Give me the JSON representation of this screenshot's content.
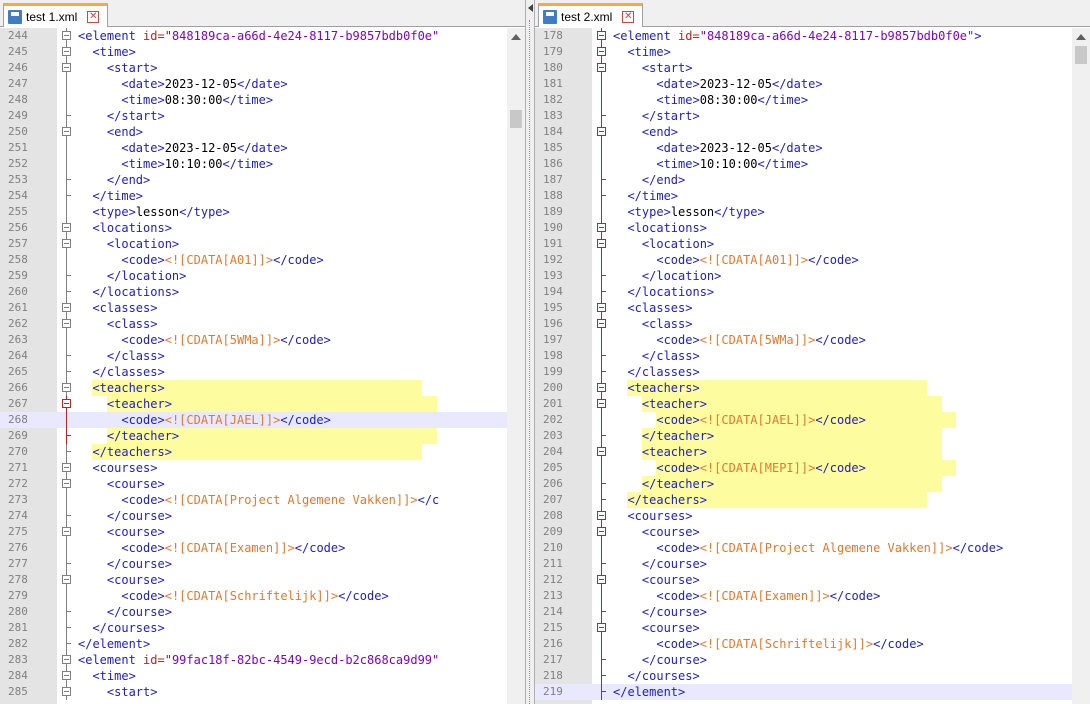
{
  "left": {
    "tab_title": "test 1.xml",
    "rows": [
      {
        "n": "244",
        "i": 3,
        "t": [
          [
            "tag",
            "<element "
          ],
          [
            "attr",
            "id="
          ],
          [
            "val",
            "\"848189ca-a66d-4e24-8117-b9857bdb0f0e\""
          ]
        ],
        "f": "box"
      },
      {
        "n": "245",
        "i": 4,
        "t": [
          [
            "tag",
            "<time>"
          ]
        ],
        "f": "box"
      },
      {
        "n": "246",
        "i": 5,
        "t": [
          [
            "tag",
            "<start>"
          ]
        ],
        "f": "box"
      },
      {
        "n": "247",
        "i": 6,
        "t": [
          [
            "tag",
            "<date>"
          ],
          [
            "txt",
            "2023-12-05"
          ],
          [
            "tag",
            "</date>"
          ]
        ],
        "f": "line"
      },
      {
        "n": "248",
        "i": 6,
        "t": [
          [
            "tag",
            "<time>"
          ],
          [
            "txt",
            "08:30:00"
          ],
          [
            "tag",
            "</time>"
          ]
        ],
        "f": "line"
      },
      {
        "n": "249",
        "i": 5,
        "t": [
          [
            "tag",
            "</start>"
          ]
        ],
        "f": "end"
      },
      {
        "n": "250",
        "i": 5,
        "t": [
          [
            "tag",
            "<end>"
          ]
        ],
        "f": "box"
      },
      {
        "n": "251",
        "i": 6,
        "t": [
          [
            "tag",
            "<date>"
          ],
          [
            "txt",
            "2023-12-05"
          ],
          [
            "tag",
            "</date>"
          ]
        ],
        "f": "line"
      },
      {
        "n": "252",
        "i": 6,
        "t": [
          [
            "tag",
            "<time>"
          ],
          [
            "txt",
            "10:10:00"
          ],
          [
            "tag",
            "</time>"
          ]
        ],
        "f": "line"
      },
      {
        "n": "253",
        "i": 5,
        "t": [
          [
            "tag",
            "</end>"
          ]
        ],
        "f": "end"
      },
      {
        "n": "254",
        "i": 4,
        "t": [
          [
            "tag",
            "</time>"
          ]
        ],
        "f": "end"
      },
      {
        "n": "255",
        "i": 4,
        "t": [
          [
            "tag",
            "<type>"
          ],
          [
            "txt",
            "lesson"
          ],
          [
            "tag",
            "</type>"
          ]
        ],
        "f": "line"
      },
      {
        "n": "256",
        "i": 4,
        "t": [
          [
            "tag",
            "<locations>"
          ]
        ],
        "f": "box"
      },
      {
        "n": "257",
        "i": 5,
        "t": [
          [
            "tag",
            "<location>"
          ]
        ],
        "f": "box"
      },
      {
        "n": "258",
        "i": 6,
        "t": [
          [
            "tag",
            "<code>"
          ],
          [
            "cdata",
            "<![CDATA[A01]]>"
          ],
          [
            "tag",
            "</code>"
          ]
        ],
        "f": "line"
      },
      {
        "n": "259",
        "i": 5,
        "t": [
          [
            "tag",
            "</location>"
          ]
        ],
        "f": "end"
      },
      {
        "n": "260",
        "i": 4,
        "t": [
          [
            "tag",
            "</locations>"
          ]
        ],
        "f": "end"
      },
      {
        "n": "261",
        "i": 4,
        "t": [
          [
            "tag",
            "<classes>"
          ]
        ],
        "f": "box"
      },
      {
        "n": "262",
        "i": 5,
        "t": [
          [
            "tag",
            "<class>"
          ]
        ],
        "f": "box"
      },
      {
        "n": "263",
        "i": 6,
        "t": [
          [
            "tag",
            "<code>"
          ],
          [
            "cdata",
            "<![CDATA[5WMa]]>"
          ],
          [
            "tag",
            "</code>"
          ]
        ],
        "f": "line"
      },
      {
        "n": "264",
        "i": 5,
        "t": [
          [
            "tag",
            "</class>"
          ]
        ],
        "f": "end"
      },
      {
        "n": "265",
        "i": 4,
        "t": [
          [
            "tag",
            "</classes>"
          ]
        ],
        "f": "end"
      },
      {
        "n": "266",
        "i": 4,
        "t": [
          [
            "tag",
            "<teachers>"
          ]
        ],
        "f": "box",
        "hl": "y"
      },
      {
        "n": "267",
        "i": 5,
        "t": [
          [
            "tag",
            "<teacher>"
          ]
        ],
        "f": "box",
        "hl": "y",
        "red": true
      },
      {
        "n": "268",
        "i": 6,
        "t": [
          [
            "tag",
            "<code>"
          ],
          [
            "cdata",
            "<![CDATA[JAEL]]>"
          ],
          [
            "tag",
            "</code>"
          ]
        ],
        "f": "line",
        "hl": "lav",
        "red": true
      },
      {
        "n": "269",
        "i": 5,
        "t": [
          [
            "tag",
            "</teacher>"
          ]
        ],
        "f": "end",
        "hl": "y",
        "red": true
      },
      {
        "n": "270",
        "i": 4,
        "t": [
          [
            "tag",
            "</teachers>"
          ]
        ],
        "f": "end",
        "hl": "y"
      },
      {
        "n": "271",
        "i": 4,
        "t": [
          [
            "tag",
            "<courses>"
          ]
        ],
        "f": "box"
      },
      {
        "n": "272",
        "i": 5,
        "t": [
          [
            "tag",
            "<course>"
          ]
        ],
        "f": "box"
      },
      {
        "n": "273",
        "i": 6,
        "t": [
          [
            "tag",
            "<code>"
          ],
          [
            "cdata",
            "<![CDATA[Project Algemene Vakken]]>"
          ],
          [
            "tag",
            "</c"
          ]
        ],
        "f": "line"
      },
      {
        "n": "274",
        "i": 5,
        "t": [
          [
            "tag",
            "</course>"
          ]
        ],
        "f": "end"
      },
      {
        "n": "275",
        "i": 5,
        "t": [
          [
            "tag",
            "<course>"
          ]
        ],
        "f": "box"
      },
      {
        "n": "276",
        "i": 6,
        "t": [
          [
            "tag",
            "<code>"
          ],
          [
            "cdata",
            "<![CDATA[Examen]]>"
          ],
          [
            "tag",
            "</code>"
          ]
        ],
        "f": "line"
      },
      {
        "n": "277",
        "i": 5,
        "t": [
          [
            "tag",
            "</course>"
          ]
        ],
        "f": "end"
      },
      {
        "n": "278",
        "i": 5,
        "t": [
          [
            "tag",
            "<course>"
          ]
        ],
        "f": "box"
      },
      {
        "n": "279",
        "i": 6,
        "t": [
          [
            "tag",
            "<code>"
          ],
          [
            "cdata",
            "<![CDATA[Schriftelijk]]>"
          ],
          [
            "tag",
            "</code>"
          ]
        ],
        "f": "line"
      },
      {
        "n": "280",
        "i": 5,
        "t": [
          [
            "tag",
            "</course>"
          ]
        ],
        "f": "end"
      },
      {
        "n": "281",
        "i": 4,
        "t": [
          [
            "tag",
            "</courses>"
          ]
        ],
        "f": "end"
      },
      {
        "n": "282",
        "i": 3,
        "t": [
          [
            "tag",
            "</element>"
          ]
        ],
        "f": "end"
      },
      {
        "n": "283",
        "i": 3,
        "t": [
          [
            "tag",
            "<element "
          ],
          [
            "attr",
            "id="
          ],
          [
            "val",
            "\"99fac18f-82bc-4549-9ecd-b2c868ca9d99\""
          ]
        ],
        "f": "box"
      },
      {
        "n": "284",
        "i": 4,
        "t": [
          [
            "tag",
            "<time>"
          ]
        ],
        "f": "box"
      },
      {
        "n": "285",
        "i": 5,
        "t": [
          [
            "tag",
            "<start>"
          ]
        ],
        "f": "box"
      }
    ]
  },
  "right": {
    "tab_title": "test 2.xml",
    "rows": [
      {
        "n": "178",
        "i": 3,
        "t": [
          [
            "tag",
            "<element "
          ],
          [
            "attr",
            "id="
          ],
          [
            "val",
            "\"848189ca-a66d-4e24-8117-b9857bdb0f0e\""
          ],
          [
            "tag",
            ">"
          ]
        ],
        "f": "box",
        "red": true
      },
      {
        "n": "179",
        "i": 4,
        "t": [
          [
            "tag",
            "<time>"
          ]
        ],
        "f": "box",
        "red": true
      },
      {
        "n": "180",
        "i": 5,
        "t": [
          [
            "tag",
            "<start>"
          ]
        ],
        "f": "box",
        "red": true
      },
      {
        "n": "181",
        "i": 6,
        "t": [
          [
            "tag",
            "<date>"
          ],
          [
            "txt",
            "2023-12-05"
          ],
          [
            "tag",
            "</date>"
          ]
        ],
        "f": "line",
        "red": true
      },
      {
        "n": "182",
        "i": 6,
        "t": [
          [
            "tag",
            "<time>"
          ],
          [
            "txt",
            "08:30:00"
          ],
          [
            "tag",
            "</time>"
          ]
        ],
        "f": "line",
        "red": true
      },
      {
        "n": "183",
        "i": 5,
        "t": [
          [
            "tag",
            "</start>"
          ]
        ],
        "f": "end",
        "red": true
      },
      {
        "n": "184",
        "i": 5,
        "t": [
          [
            "tag",
            "<end>"
          ]
        ],
        "f": "box",
        "red": true
      },
      {
        "n": "185",
        "i": 6,
        "t": [
          [
            "tag",
            "<date>"
          ],
          [
            "txt",
            "2023-12-05"
          ],
          [
            "tag",
            "</date>"
          ]
        ],
        "f": "line",
        "red": true
      },
      {
        "n": "186",
        "i": 6,
        "t": [
          [
            "tag",
            "<time>"
          ],
          [
            "txt",
            "10:10:00"
          ],
          [
            "tag",
            "</time>"
          ]
        ],
        "f": "line",
        "red": true
      },
      {
        "n": "187",
        "i": 5,
        "t": [
          [
            "tag",
            "</end>"
          ]
        ],
        "f": "end",
        "red": true
      },
      {
        "n": "188",
        "i": 4,
        "t": [
          [
            "tag",
            "</time>"
          ]
        ],
        "f": "end",
        "red": true
      },
      {
        "n": "189",
        "i": 4,
        "t": [
          [
            "tag",
            "<type>"
          ],
          [
            "txt",
            "lesson"
          ],
          [
            "tag",
            "</type>"
          ]
        ],
        "f": "line",
        "red": true
      },
      {
        "n": "190",
        "i": 4,
        "t": [
          [
            "tag",
            "<locations>"
          ]
        ],
        "f": "box",
        "red": true
      },
      {
        "n": "191",
        "i": 5,
        "t": [
          [
            "tag",
            "<location>"
          ]
        ],
        "f": "box",
        "red": true
      },
      {
        "n": "192",
        "i": 6,
        "t": [
          [
            "tag",
            "<code>"
          ],
          [
            "cdata",
            "<![CDATA[A01]]>"
          ],
          [
            "tag",
            "</code>"
          ]
        ],
        "f": "line",
        "red": true
      },
      {
        "n": "193",
        "i": 5,
        "t": [
          [
            "tag",
            "</location>"
          ]
        ],
        "f": "end",
        "red": true
      },
      {
        "n": "194",
        "i": 4,
        "t": [
          [
            "tag",
            "</locations>"
          ]
        ],
        "f": "end",
        "red": true
      },
      {
        "n": "195",
        "i": 4,
        "t": [
          [
            "tag",
            "<classes>"
          ]
        ],
        "f": "box",
        "red": true
      },
      {
        "n": "196",
        "i": 5,
        "t": [
          [
            "tag",
            "<class>"
          ]
        ],
        "f": "box",
        "red": true
      },
      {
        "n": "197",
        "i": 6,
        "t": [
          [
            "tag",
            "<code>"
          ],
          [
            "cdata",
            "<![CDATA[5WMa]]>"
          ],
          [
            "tag",
            "</code>"
          ]
        ],
        "f": "line",
        "red": true
      },
      {
        "n": "198",
        "i": 5,
        "t": [
          [
            "tag",
            "</class>"
          ]
        ],
        "f": "end",
        "red": true
      },
      {
        "n": "199",
        "i": 4,
        "t": [
          [
            "tag",
            "</classes>"
          ]
        ],
        "f": "end",
        "red": true
      },
      {
        "n": "200",
        "i": 4,
        "t": [
          [
            "tag",
            "<teachers>"
          ]
        ],
        "f": "box",
        "hl": "y",
        "red": true
      },
      {
        "n": "201",
        "i": 5,
        "t": [
          [
            "tag",
            "<teacher>"
          ]
        ],
        "f": "box",
        "hl": "y",
        "red": true
      },
      {
        "n": "202",
        "i": 6,
        "t": [
          [
            "tag",
            "<code>"
          ],
          [
            "cdata",
            "<![CDATA[JAEL]]>"
          ],
          [
            "tag",
            "</code>"
          ]
        ],
        "f": "line",
        "hl": "y",
        "red": true
      },
      {
        "n": "203",
        "i": 5,
        "t": [
          [
            "tag",
            "</teacher>"
          ]
        ],
        "f": "end",
        "hl": "y",
        "red": true
      },
      {
        "n": "204",
        "i": 5,
        "t": [
          [
            "tag",
            "<teacher>"
          ]
        ],
        "f": "box",
        "hl": "y",
        "red": true
      },
      {
        "n": "205",
        "i": 6,
        "t": [
          [
            "tag",
            "<code>"
          ],
          [
            "cdata",
            "<![CDATA[MEPI]]>"
          ],
          [
            "tag",
            "</code>"
          ]
        ],
        "f": "line",
        "hl": "y",
        "red": true
      },
      {
        "n": "206",
        "i": 5,
        "t": [
          [
            "tag",
            "</teacher>"
          ]
        ],
        "f": "end",
        "hl": "y",
        "red": true
      },
      {
        "n": "207",
        "i": 4,
        "t": [
          [
            "tag",
            "</teachers>"
          ]
        ],
        "f": "end",
        "hl": "y",
        "red": true
      },
      {
        "n": "208",
        "i": 4,
        "t": [
          [
            "tag",
            "<courses>"
          ]
        ],
        "f": "box",
        "red": true
      },
      {
        "n": "209",
        "i": 5,
        "t": [
          [
            "tag",
            "<course>"
          ]
        ],
        "f": "box",
        "red": true
      },
      {
        "n": "210",
        "i": 6,
        "t": [
          [
            "tag",
            "<code>"
          ],
          [
            "cdata",
            "<![CDATA[Project Algemene Vakken]]>"
          ],
          [
            "tag",
            "</code>"
          ]
        ],
        "f": "line",
        "red": true
      },
      {
        "n": "211",
        "i": 5,
        "t": [
          [
            "tag",
            "</course>"
          ]
        ],
        "f": "end",
        "red": true
      },
      {
        "n": "212",
        "i": 5,
        "t": [
          [
            "tag",
            "<course>"
          ]
        ],
        "f": "box",
        "red": true
      },
      {
        "n": "213",
        "i": 6,
        "t": [
          [
            "tag",
            "<code>"
          ],
          [
            "cdata",
            "<![CDATA[Examen]]>"
          ],
          [
            "tag",
            "</code>"
          ]
        ],
        "f": "line",
        "red": true
      },
      {
        "n": "214",
        "i": 5,
        "t": [
          [
            "tag",
            "</course>"
          ]
        ],
        "f": "end",
        "red": true
      },
      {
        "n": "215",
        "i": 5,
        "t": [
          [
            "tag",
            "<course>"
          ]
        ],
        "f": "box",
        "red": true
      },
      {
        "n": "216",
        "i": 6,
        "t": [
          [
            "tag",
            "<code>"
          ],
          [
            "cdata",
            "<![CDATA[Schriftelijk]]>"
          ],
          [
            "tag",
            "</code>"
          ]
        ],
        "f": "line",
        "red": true
      },
      {
        "n": "217",
        "i": 5,
        "t": [
          [
            "tag",
            "</course>"
          ]
        ],
        "f": "end",
        "red": true
      },
      {
        "n": "218",
        "i": 4,
        "t": [
          [
            "tag",
            "</courses>"
          ]
        ],
        "f": "end",
        "red": true
      },
      {
        "n": "219",
        "i": 3,
        "t": [
          [
            "tag",
            "</element>"
          ]
        ],
        "f": "end",
        "hl": "lav",
        "red": true
      }
    ]
  },
  "colors": {
    "tag": "#2020c0",
    "attribute": "#c02020",
    "attribute_value": "#8000c0",
    "cdata": "#e07830",
    "diff_highlight": "#fdfd9f",
    "current_line": "#e8e8ff",
    "tab_accent": "#f7a94a"
  },
  "icons": {
    "tab_icon": "save-file-icon",
    "tab_close": "close-icon",
    "fold_marker": "fold-minus-icon"
  }
}
